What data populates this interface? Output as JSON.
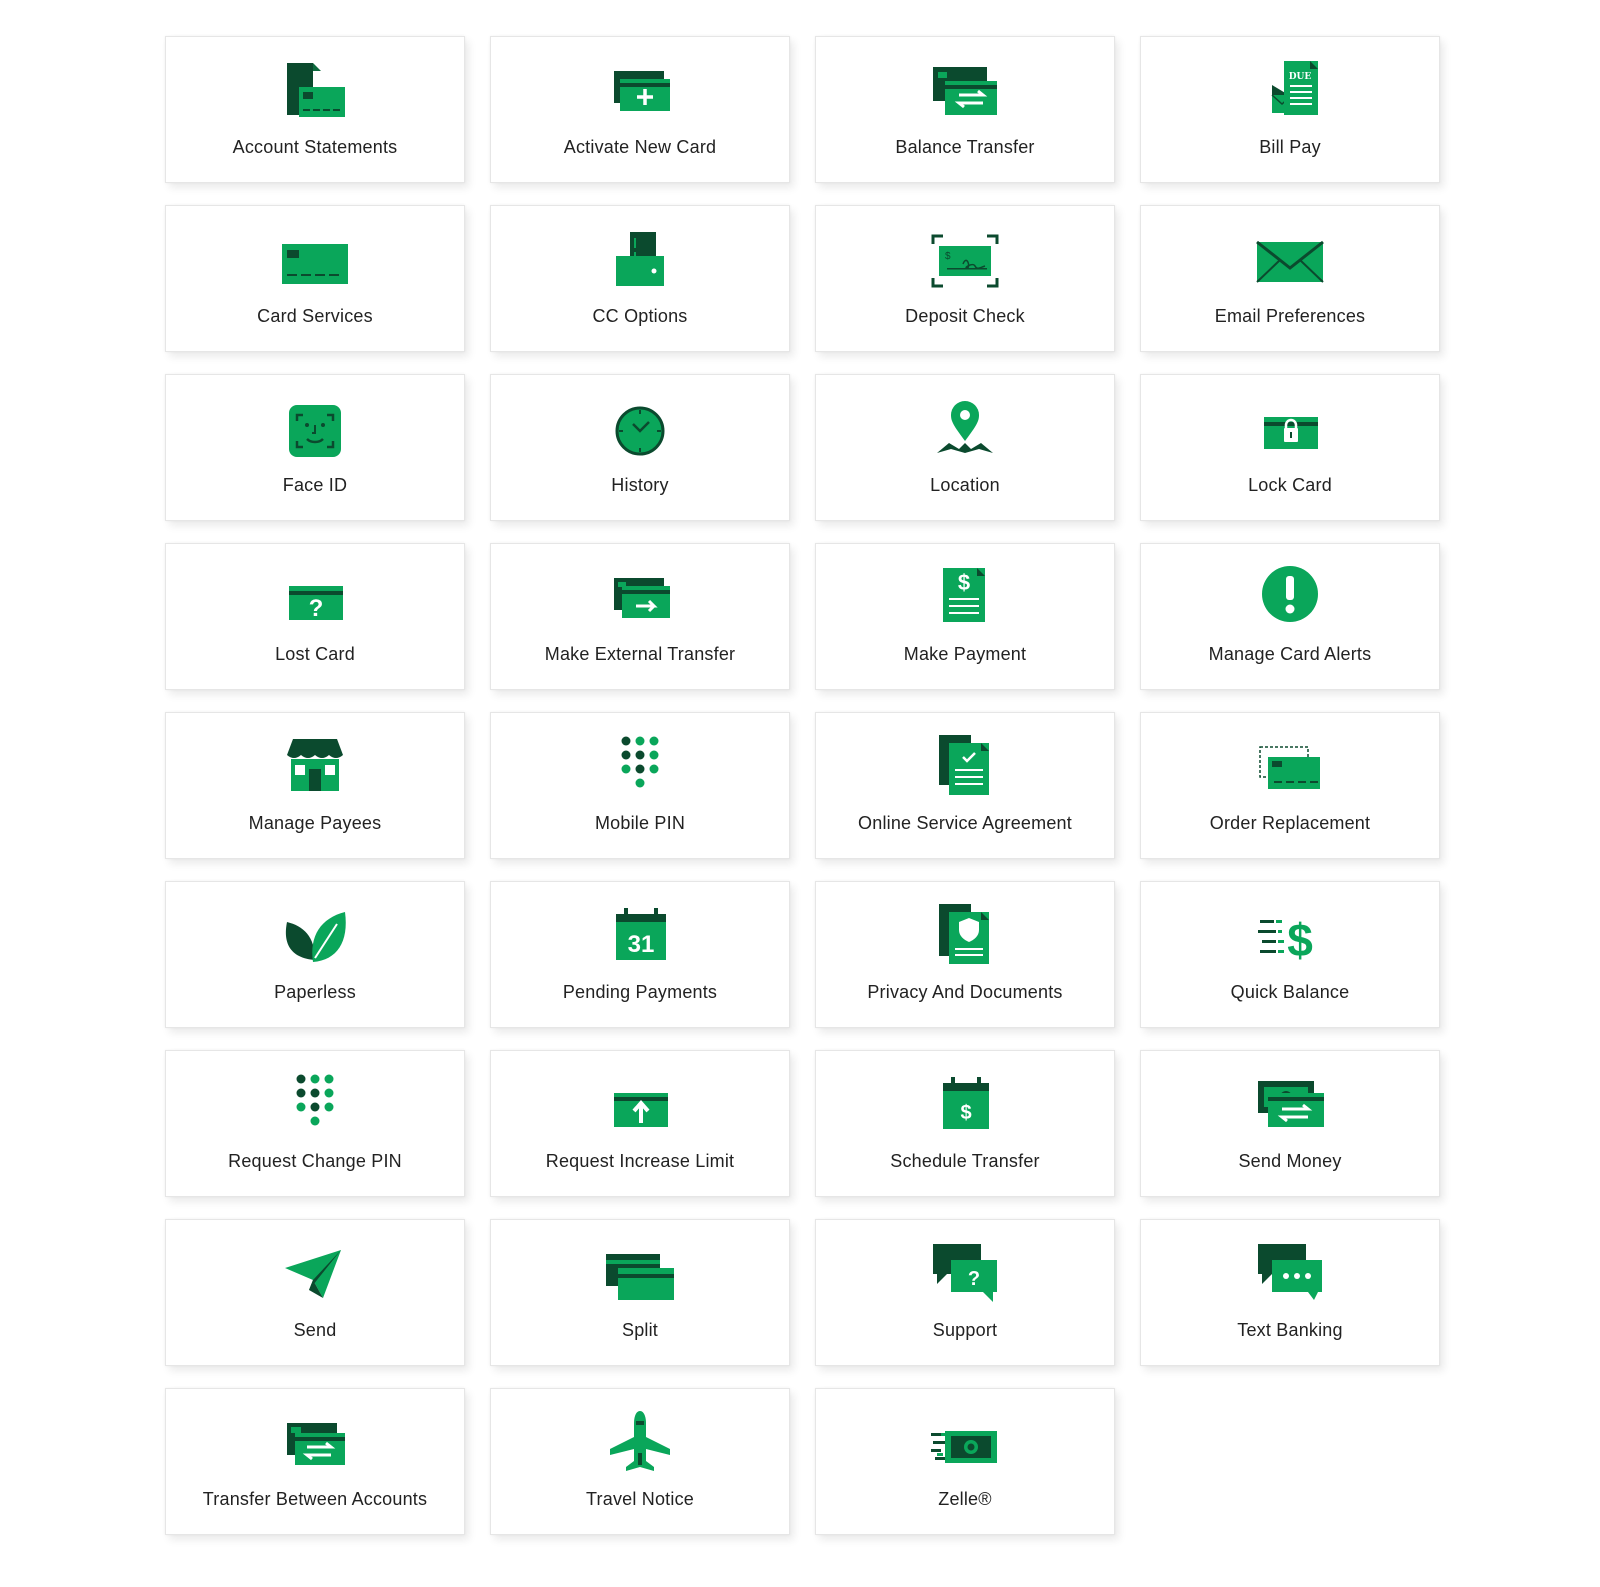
{
  "colors": {
    "green": "#0aa65a",
    "dark_green": "#0b4a2e",
    "tile_border": "#e6e6e6",
    "text": "#222222"
  },
  "tiles": [
    {
      "label": "Account Statements",
      "icon": "statements-icon"
    },
    {
      "label": "Activate New Card",
      "icon": "card-plus-icon"
    },
    {
      "label": "Balance Transfer",
      "icon": "card-transfer-icon"
    },
    {
      "label": "Bill Pay",
      "icon": "bill-due-icon",
      "icon_text": "DUE"
    },
    {
      "label": "Card Services",
      "icon": "credit-card-icon"
    },
    {
      "label": "CC Options",
      "icon": "card-wallet-icon"
    },
    {
      "label": "Deposit Check",
      "icon": "check-scan-icon",
      "icon_text": "$"
    },
    {
      "label": "Email Preferences",
      "icon": "envelope-icon"
    },
    {
      "label": "Face ID",
      "icon": "face-id-icon"
    },
    {
      "label": "History",
      "icon": "clock-icon"
    },
    {
      "label": "Location",
      "icon": "map-pin-icon"
    },
    {
      "label": "Lock Card",
      "icon": "card-lock-icon"
    },
    {
      "label": "Lost Card",
      "icon": "card-question-icon",
      "icon_text": "?"
    },
    {
      "label": "Make External Transfer",
      "icon": "card-arrow-icon"
    },
    {
      "label": "Make Payment",
      "icon": "dollar-document-icon",
      "icon_text": "$"
    },
    {
      "label": "Manage Card Alerts",
      "icon": "exclamation-icon"
    },
    {
      "label": "Manage Payees",
      "icon": "storefront-icon"
    },
    {
      "label": "Mobile PIN",
      "icon": "keypad-icon"
    },
    {
      "label": "Online Service Agreement",
      "icon": "document-check-icon"
    },
    {
      "label": "Order Replacement",
      "icon": "card-replace-icon"
    },
    {
      "label": "Paperless",
      "icon": "leaves-icon"
    },
    {
      "label": "Pending Payments",
      "icon": "calendar-icon",
      "icon_text": "31"
    },
    {
      "label": "Privacy And Documents",
      "icon": "document-shield-icon"
    },
    {
      "label": "Quick Balance",
      "icon": "fast-dollar-icon",
      "icon_text": "$"
    },
    {
      "label": "Request Change PIN",
      "icon": "keypad-icon"
    },
    {
      "label": "Request Increase Limit",
      "icon": "card-up-arrow-icon"
    },
    {
      "label": "Schedule Transfer",
      "icon": "calendar-dollar-icon",
      "icon_text": "$"
    },
    {
      "label": "Send Money",
      "icon": "money-transfer-icon"
    },
    {
      "label": "Send",
      "icon": "paper-plane-icon"
    },
    {
      "label": "Split",
      "icon": "split-cards-icon"
    },
    {
      "label": "Support",
      "icon": "chat-question-icon",
      "icon_text": "?"
    },
    {
      "label": "Text Banking",
      "icon": "chat-dots-icon"
    },
    {
      "label": "Transfer Between Accounts",
      "icon": "cards-exchange-icon"
    },
    {
      "label": "Travel Notice",
      "icon": "airplane-icon"
    },
    {
      "label": "Zelle®",
      "icon": "fast-money-icon"
    }
  ]
}
